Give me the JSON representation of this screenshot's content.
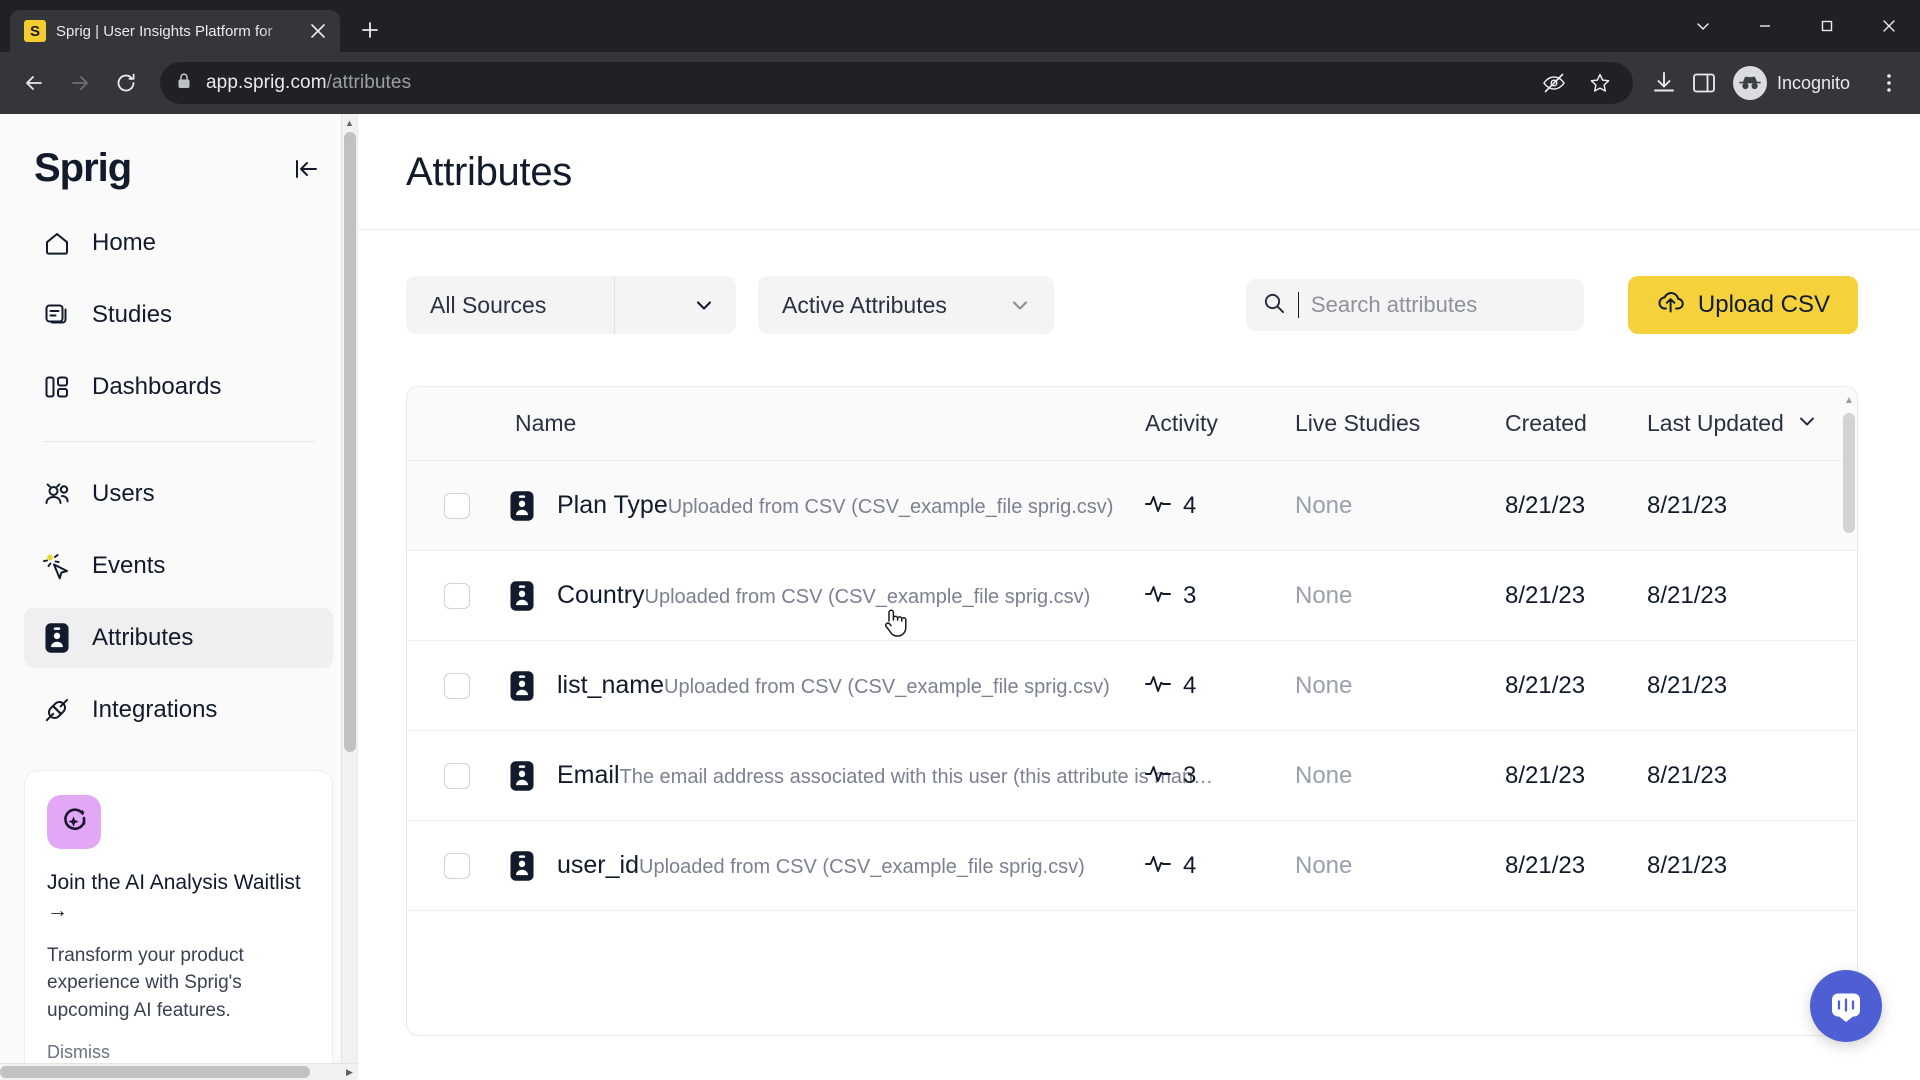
{
  "browser": {
    "tab": {
      "title": "Sprig | User Insights Platform for",
      "favicon_letter": "S",
      "favicon_color": "#F2CC2F",
      "close_icon": "close-icon"
    },
    "newtab_label": "+",
    "window_controls": {
      "minimize": "–",
      "maximize": "□",
      "close": "✕",
      "chevron": "∨"
    },
    "address": {
      "url_host": "app.sprig.com",
      "url_path": "/attributes",
      "lock_icon": "lock-icon"
    },
    "profile": {
      "label": "Incognito"
    }
  },
  "sidebar": {
    "logo": "Sprig",
    "collapse_icon": "collapse-panel-icon",
    "items": [
      {
        "label": "Home",
        "icon": "home-icon",
        "active": false
      },
      {
        "label": "Studies",
        "icon": "studies-icon",
        "active": false
      },
      {
        "label": "Dashboards",
        "icon": "dashboards-icon",
        "active": false
      },
      {
        "label": "Users",
        "icon": "users-icon",
        "active": false
      },
      {
        "label": "Events",
        "icon": "events-cursor-icon",
        "active": false
      },
      {
        "label": "Attributes",
        "icon": "attributes-id-icon",
        "active": true
      },
      {
        "label": "Integrations",
        "icon": "integrations-plug-icon",
        "active": false
      }
    ],
    "ai_card": {
      "icon": "ai-sparkle-icon",
      "icon_bg": "#E3A8F5",
      "title": "Join the AI Analysis Waitlist →",
      "body": "Transform your product experience with Sprig's upcoming AI features.",
      "dismiss_label": "Dismiss"
    }
  },
  "page": {
    "title": "Attributes"
  },
  "controls": {
    "source_filter": {
      "value": "All Sources",
      "caret_icon": "chevron-down-icon"
    },
    "status_filter": {
      "value": "Active Attributes",
      "caret_icon": "chevron-down-icon"
    },
    "search": {
      "value": "",
      "placeholder": "Search attributes",
      "icon": "search-icon"
    },
    "upload_button": {
      "label": "Upload CSV",
      "icon": "upload-cloud-icon",
      "color": "#F5D13B"
    }
  },
  "table": {
    "columns": [
      "Name",
      "Activity",
      "Live Studies",
      "Created",
      "Last Updated"
    ],
    "sorted_column": "Last Updated",
    "sort_icon": "chevron-down-icon",
    "rows": [
      {
        "name": "Plan Type",
        "description": "Uploaded from CSV (CSV_example_file sprig.csv)",
        "activity": "4",
        "live_studies": "None",
        "created": "8/21/23",
        "last_updated": "8/21/23",
        "checked": false
      },
      {
        "name": "Country",
        "description": "Uploaded from CSV (CSV_example_file sprig.csv)",
        "activity": "3",
        "live_studies": "None",
        "created": "8/21/23",
        "last_updated": "8/21/23",
        "checked": false
      },
      {
        "name": "list_name",
        "description": "Uploaded from CSV (CSV_example_file sprig.csv)",
        "activity": "4",
        "live_studies": "None",
        "created": "8/21/23",
        "last_updated": "8/21/23",
        "checked": false
      },
      {
        "name": "Email",
        "description": "The email address associated with this user (this attribute is man…",
        "activity": "3",
        "live_studies": "None",
        "created": "8/21/23",
        "last_updated": "8/21/23",
        "checked": false
      },
      {
        "name": "user_id",
        "description": "Uploaded from CSV (CSV_example_file sprig.csv)",
        "activity": "4",
        "live_studies": "None",
        "created": "8/21/23",
        "last_updated": "8/21/23",
        "checked": false
      }
    ]
  },
  "support": {
    "launcher_icon": "intercom-chat-icon",
    "color": "#4E5FD4"
  }
}
